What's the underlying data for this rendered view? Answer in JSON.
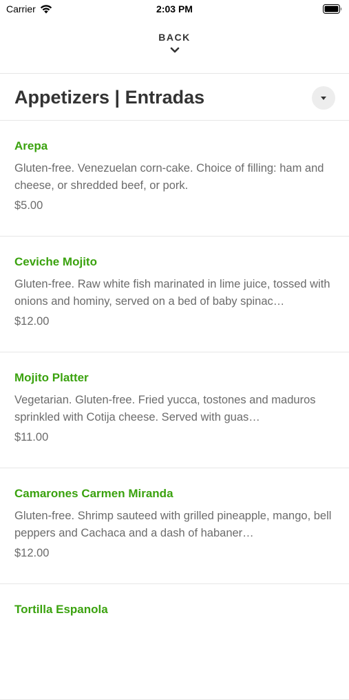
{
  "status_bar": {
    "carrier": "Carrier",
    "time": "2:03 PM"
  },
  "nav": {
    "back_label": "BACK"
  },
  "category": {
    "title": "Appetizers | Entradas"
  },
  "colors": {
    "accent_green": "#3aa20e",
    "text_gray": "#6b6b6b"
  },
  "items": [
    {
      "name": "Arepa",
      "description": "Gluten-free. Venezuelan corn-cake. Choice of filling: ham and cheese, or shredded beef, or pork.",
      "price": "$5.00"
    },
    {
      "name": "Ceviche Mojito",
      "description": "Gluten-free. Raw white fish marinated in lime juice, tossed with onions and hominy, served on a bed of baby spinac…",
      "price": "$12.00"
    },
    {
      "name": "Mojito Platter",
      "description": "Vegetarian. Gluten-free. Fried yucca, tostones and maduros sprinkled with Cotija cheese. Served with guas…",
      "price": "$11.00"
    },
    {
      "name": "Camarones Carmen Miranda",
      "description": "Gluten-free. Shrimp sauteed with grilled pineapple, mango, bell peppers and Cachaca and a dash of habaner…",
      "price": "$12.00"
    },
    {
      "name": "Tortilla Espanola",
      "description": "",
      "price": ""
    }
  ]
}
